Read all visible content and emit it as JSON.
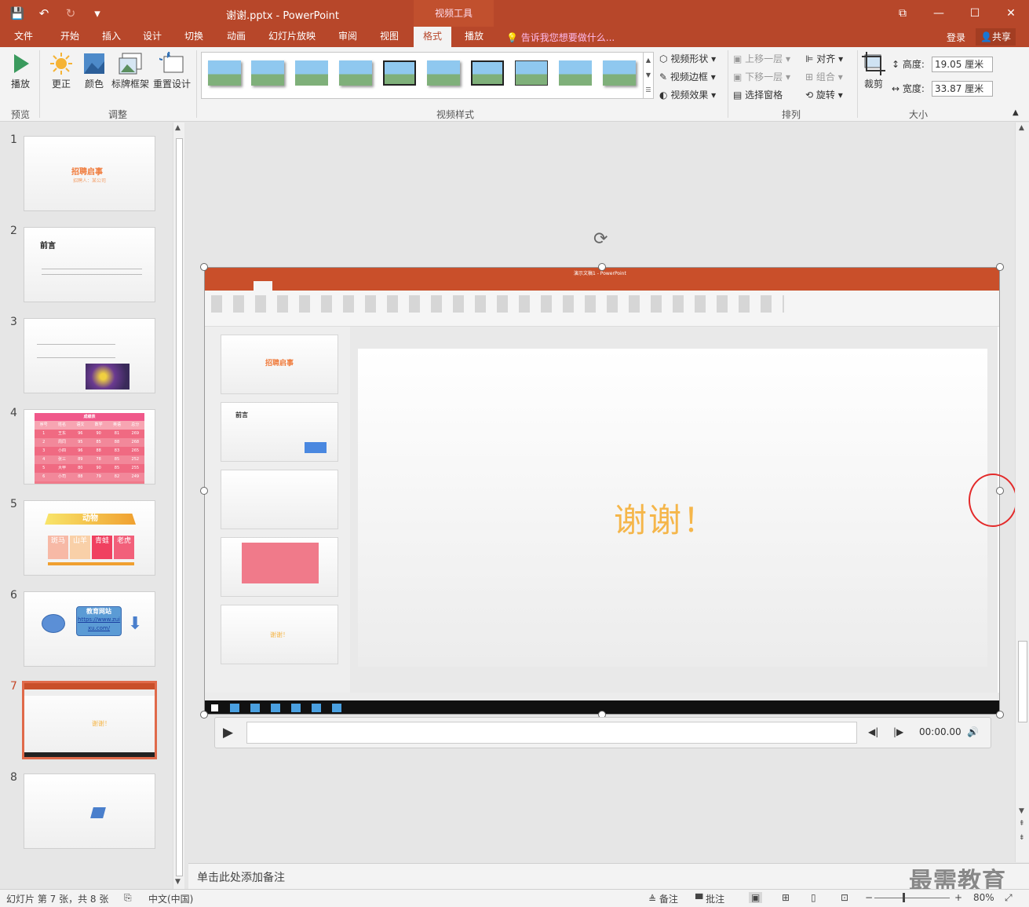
{
  "app": {
    "title": "谢谢.pptx - PowerPoint",
    "context_tab": "视频工具",
    "window_buttons": [
      "⧉",
      "—",
      "☐",
      "✕"
    ]
  },
  "qat": [
    "💾",
    "↶",
    "↻",
    "▾"
  ],
  "tabs": [
    {
      "label": "文件",
      "active": false
    },
    {
      "label": "开始",
      "active": false
    },
    {
      "label": "插入",
      "active": false
    },
    {
      "label": "设计",
      "active": false
    },
    {
      "label": "切换",
      "active": false
    },
    {
      "label": "动画",
      "active": false
    },
    {
      "label": "幻灯片放映",
      "active": false
    },
    {
      "label": "审阅",
      "active": false
    },
    {
      "label": "视图",
      "active": false
    },
    {
      "label": "格式",
      "active": true
    },
    {
      "label": "播放",
      "active": false
    }
  ],
  "tell_me": "告诉我您想要做什么...",
  "account": {
    "login": "登录",
    "share": "共享"
  },
  "ribbon": {
    "preview": {
      "play_label": "播放",
      "group": "预览"
    },
    "adjust": {
      "correct": "更正",
      "color": "颜色",
      "poster": "标牌框架",
      "reset": "重置设计",
      "group": "调整"
    },
    "styles": {
      "group": "视频样式",
      "shape": "视频形状",
      "border": "视频边框",
      "effects": "视频效果"
    },
    "arrange": {
      "bring_forward": "上移一层",
      "send_backward": "下移一层",
      "selection_pane": "选择窗格",
      "align": "对齐",
      "group_btn": "组合",
      "rotate": "旋转",
      "group": "排列"
    },
    "size": {
      "crop": "裁剪",
      "height_label": "高度:",
      "height_value": "19.05 厘米",
      "width_label": "宽度:",
      "width_value": "33.87 厘米",
      "group": "大小"
    }
  },
  "slides": [
    {
      "num": "1",
      "title": "招聘启事",
      "sub": "招聘人：某公司"
    },
    {
      "num": "2",
      "title": "前言"
    },
    {
      "num": "3",
      "title": ""
    },
    {
      "num": "4",
      "title": "成绩表",
      "headers": [
        "序号",
        "姓名",
        "语文",
        "数学",
        "英语",
        "总分"
      ],
      "rows": [
        [
          "1",
          "王东",
          "96",
          "90",
          "81",
          "269"
        ],
        [
          "2",
          "周同",
          "95",
          "85",
          "88",
          "268"
        ],
        [
          "3",
          "小四",
          "96",
          "88",
          "83",
          "265"
        ],
        [
          "4",
          "张三",
          "89",
          "78",
          "85",
          "252"
        ],
        [
          "5",
          "大甲",
          "80",
          "90",
          "85",
          "255"
        ],
        [
          "6",
          "小司",
          "88",
          "79",
          "82",
          "249"
        ]
      ]
    },
    {
      "num": "5",
      "title": "动物",
      "cells": [
        "斑马",
        "山羊",
        "青蛙",
        "老虎"
      ]
    },
    {
      "num": "6",
      "box_title": "教育网站",
      "box_link": "https://www.zuixu.com/"
    },
    {
      "num": "7",
      "title": "谢谢！"
    },
    {
      "num": "8",
      "title": ""
    }
  ],
  "video_inner": {
    "title": "演示文稿1 - PowerPoint",
    "canvas_text": "谢谢！",
    "slide1_title": "招聘启事",
    "slide2_title": "前言",
    "slide5_text": "谢谢！"
  },
  "player": {
    "time": "00:00.00"
  },
  "notes_placeholder": "单击此处添加备注",
  "status": {
    "slide_info": "幻灯片 第 7 张，共 8 张",
    "language": "中文(中国)",
    "notes": "备注",
    "comments": "批注",
    "zoom": "80%"
  },
  "watermark": "最需教育",
  "colors": {
    "accent": "#b7472a",
    "selected_slide": "#e06a4a",
    "annotation": "#e32a2a"
  }
}
